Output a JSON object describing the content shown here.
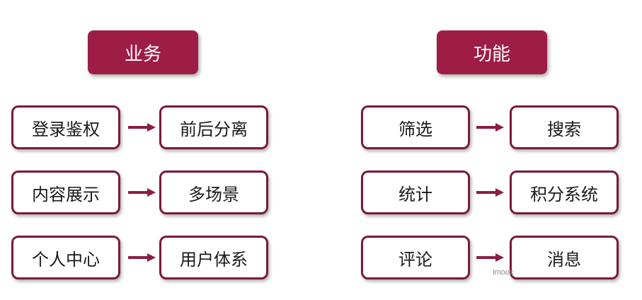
{
  "colors": {
    "header_bg": "#9e1d46",
    "box_border": "#7a1a3a",
    "arrow": "#8c1d44"
  },
  "left": {
    "header": "业务",
    "rows": [
      {
        "from": "登录鉴权",
        "to": "前后分离"
      },
      {
        "from": "内容展示",
        "to": "多场景"
      },
      {
        "from": "个人中心",
        "to": "用户体系"
      }
    ]
  },
  "right": {
    "header": "功能",
    "rows": [
      {
        "from": "筛选",
        "to": "搜索"
      },
      {
        "from": "统计",
        "to": "积分系统"
      },
      {
        "from": "评论",
        "to": "消息"
      }
    ]
  },
  "watermark": "imooc"
}
